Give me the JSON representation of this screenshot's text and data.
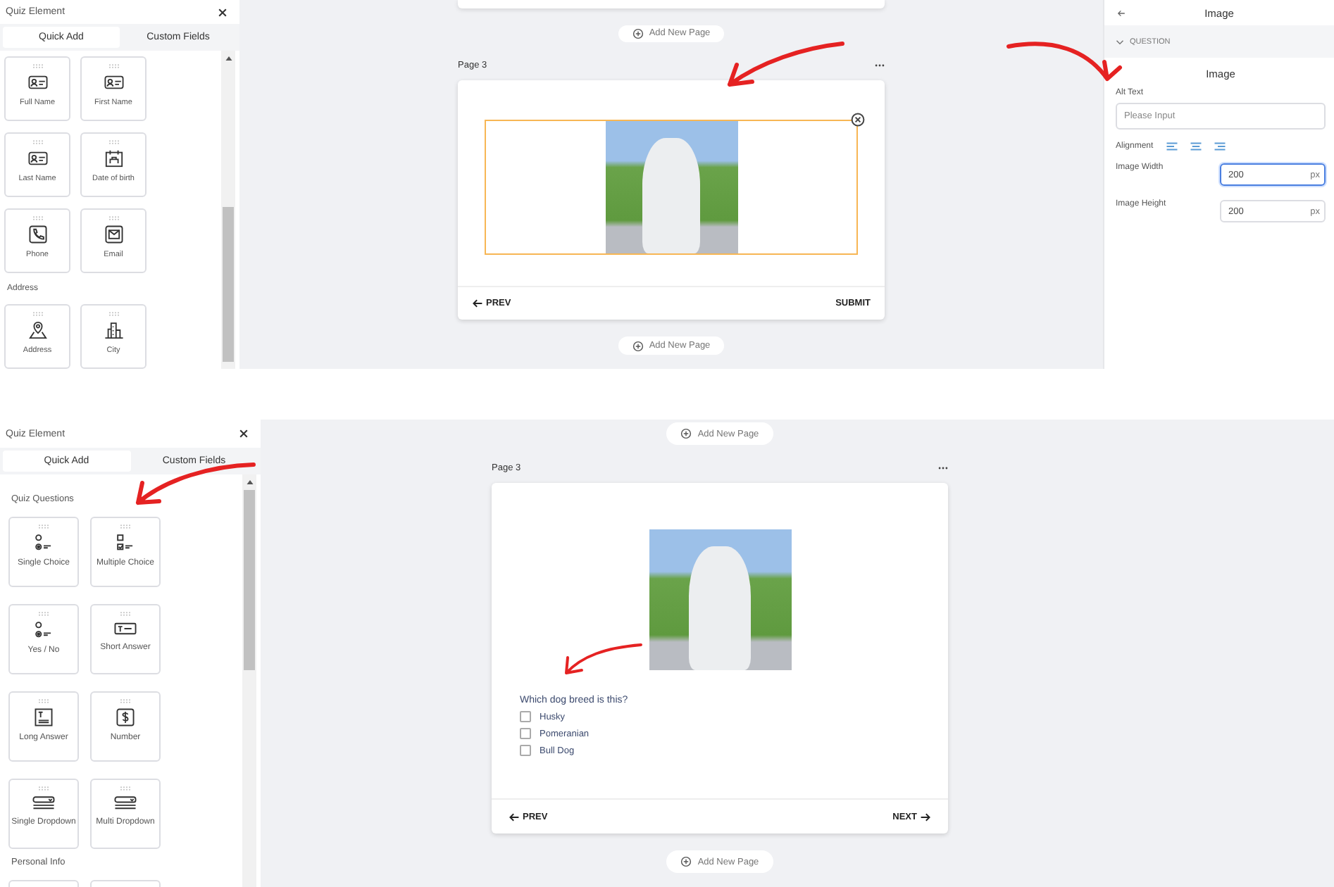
{
  "views": [
    {
      "kind": "image_settings",
      "sidebar": {
        "title": "Quiz Element",
        "tabs": [
          {
            "label": "Quick Add",
            "selected": true
          },
          {
            "label": "Custom Fields",
            "selected": false
          }
        ],
        "sections": [
          {
            "items": [
              {
                "label": "Full Name",
                "kind": "id_card"
              },
              {
                "label": "First Name",
                "kind": "id_card"
              },
              {
                "label": "Last Name",
                "kind": "id_card"
              },
              {
                "label": "Date of birth",
                "kind": "calendar"
              },
              {
                "label": "Phone",
                "kind": "phone"
              },
              {
                "label": "Email",
                "kind": "mail"
              }
            ]
          },
          {
            "heading": "Address",
            "items": [
              {
                "label": "Address",
                "kind": "pin"
              },
              {
                "label": "City",
                "kind": "building"
              }
            ]
          }
        ]
      },
      "canvas": {
        "items": [
          {
            "kind": "page_stub"
          },
          {
            "kind": "add_page",
            "label": "Add New Page"
          },
          {
            "kind": "page",
            "label": "Page 3",
            "body": [
              {
                "kind": "image",
                "selected": true
              }
            ],
            "footer": {
              "prev": "PREV",
              "next": "SUBMIT",
              "next_arrow": false
            }
          },
          {
            "kind": "add_page",
            "label": "Add New Page"
          }
        ]
      },
      "settings": {
        "title": "Image",
        "section": "QUESTION",
        "expanded": true,
        "heading": "Image",
        "fields": [
          {
            "kind": "text",
            "label": "Alt Text",
            "placeholder": "Please Input"
          },
          {
            "kind": "alignment",
            "label": "Alignment"
          },
          {
            "kind": "number",
            "label": "Image Width",
            "value": "200",
            "unit": "px",
            "focused": true
          },
          {
            "kind": "number",
            "label": "Image Height",
            "value": "200",
            "unit": "px",
            "focused": false
          }
        ]
      }
    },
    {
      "kind": "question_preview",
      "sidebar": {
        "title": "Quiz Element",
        "tabs": [
          {
            "label": "Quick Add",
            "selected": true
          },
          {
            "label": "Custom Fields",
            "selected": false
          }
        ],
        "sections": [
          {
            "heading": "Quiz Questions",
            "items": [
              {
                "label": "Single Choice",
                "kind": "radio"
              },
              {
                "label": "Multiple Choice",
                "kind": "checkbox"
              },
              {
                "label": "Yes / No",
                "kind": "radio"
              },
              {
                "label": "Short Answer",
                "kind": "text_field"
              },
              {
                "label": "Long Answer",
                "kind": "text_area"
              },
              {
                "label": "Number",
                "kind": "dollar"
              },
              {
                "label": "Single Dropdown",
                "kind": "dropdown"
              },
              {
                "label": "Multi Dropdown",
                "kind": "dropdown"
              }
            ]
          },
          {
            "heading": "Personal Info",
            "items": [
              {
                "kind": "blank"
              },
              {
                "kind": "blank"
              }
            ]
          }
        ]
      },
      "canvas": {
        "items": [
          {
            "kind": "add_page",
            "label": "Add New Page"
          },
          {
            "kind": "page",
            "label": "Page 3",
            "body": [
              {
                "kind": "image",
                "selected": false
              },
              {
                "kind": "question",
                "text": "Which dog breed is this?",
                "options": [
                  {
                    "label": "Husky",
                    "checked": false
                  },
                  {
                    "label": "Pomeranian",
                    "checked": false
                  },
                  {
                    "label": "Bull Dog",
                    "checked": false
                  }
                ]
              }
            ],
            "footer": {
              "prev": "PREV",
              "next": "NEXT",
              "next_arrow": true
            }
          },
          {
            "kind": "add_page",
            "label": "Add New Page"
          }
        ]
      }
    }
  ]
}
